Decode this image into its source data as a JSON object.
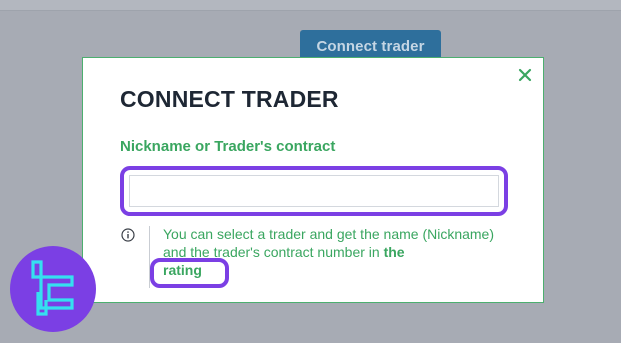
{
  "background": {
    "connect_button_label": "Connect trader"
  },
  "modal": {
    "title": "CONNECT TRADER",
    "close_icon": "close-icon",
    "field_label": "Nickname or Trader's contract",
    "input": {
      "value": "",
      "placeholder": ""
    },
    "hint": {
      "info_icon": "info-icon",
      "text": "You can select a trader and get the name (Nickname) and the trader's contract number in ",
      "link_text_1": "the",
      "link_text_2": "rating"
    }
  },
  "logo": {
    "name": "brand-logo"
  },
  "colors": {
    "accent_green": "#3aa660",
    "highlight_purple": "#7b3fe4",
    "title_dark": "#1e2734",
    "button_blue": "#2e6f9c",
    "logo_purple": "#7b3fe4",
    "logo_cyan": "#35e0f0"
  }
}
